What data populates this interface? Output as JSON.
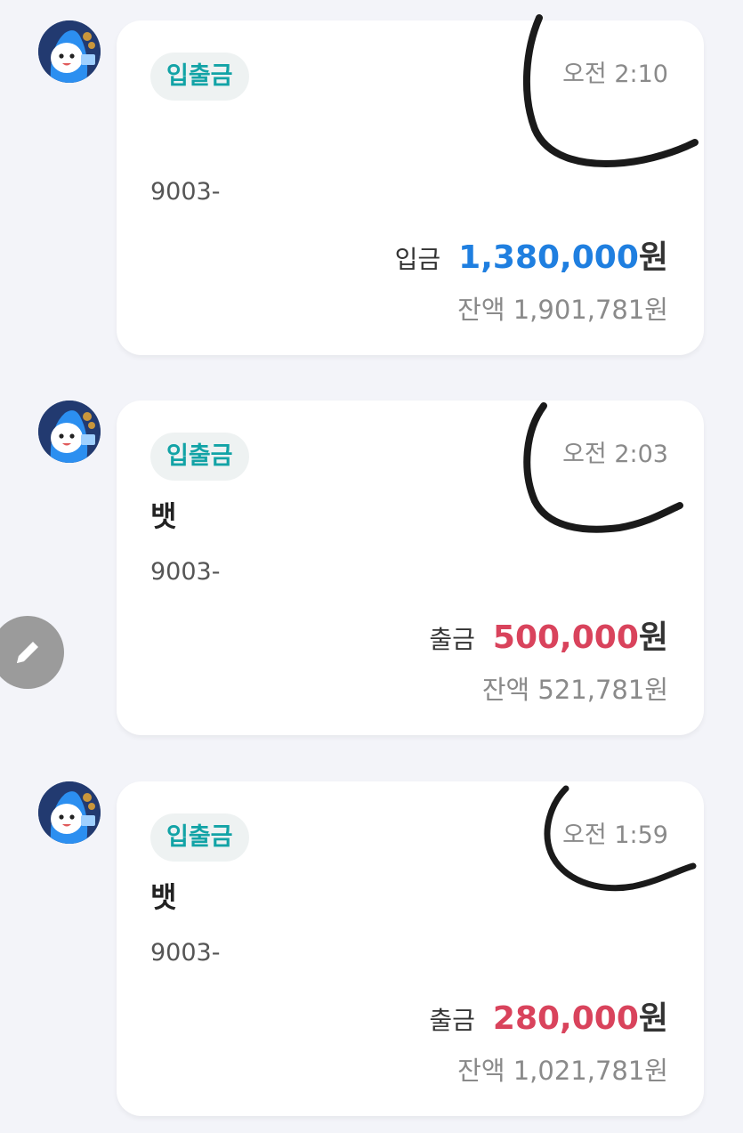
{
  "transactions": [
    {
      "badge": "입출금",
      "time": "오전 2:10",
      "name": "",
      "account": "9003-",
      "type_label": "입금",
      "amount": "1,380,000",
      "currency": "원",
      "balance": "잔액 1,901,781원",
      "amount_color": "#1f7fe0"
    },
    {
      "badge": "입출금",
      "time": "오전 2:03",
      "name": "뱃",
      "account": "9003-",
      "type_label": "출금",
      "amount": "500,000",
      "currency": "원",
      "balance": "잔액 521,781원",
      "amount_color": "#d9435c"
    },
    {
      "badge": "입출금",
      "time": "오전 1:59",
      "name": "뱃",
      "account": "9003-",
      "type_label": "출금",
      "amount": "280,000",
      "currency": "원",
      "balance": "잔액 1,021,781원",
      "amount_color": "#d9435c"
    }
  ],
  "fab": {
    "icon": "pencil-icon"
  },
  "avatar": {
    "icon": "mascot-avatar-icon"
  }
}
